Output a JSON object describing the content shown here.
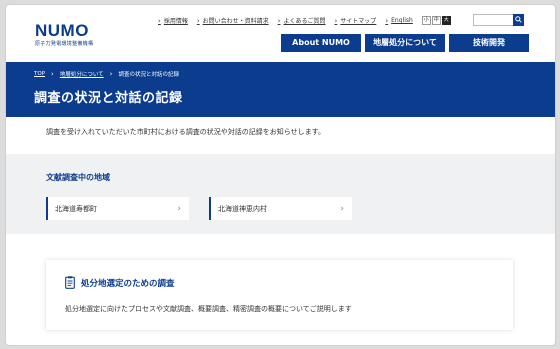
{
  "header": {
    "logo_word": "NUMO",
    "logo_sub": "原子力発電環境整備機構",
    "utility_links": [
      "採用情報",
      "お問い合わせ・資料請求",
      "よくあるご質問",
      "サイトマップ",
      "English"
    ],
    "font_size_buttons": [
      "小",
      "中",
      "大"
    ],
    "search_placeholder": "",
    "nav": [
      "About NUMO",
      "地層処分について",
      "技術開発"
    ]
  },
  "breadcrumb": [
    "TOP",
    "地層処分について",
    "調査の状況と対話の記録"
  ],
  "page_title": "調査の状況と対話の記録",
  "intro": "調査を受け入れていただいた市町村における調査の状況や対話の記録をお知らせします。",
  "survey": {
    "title": "文献調査中の地域",
    "towns": [
      "北海道寿都町",
      "北海道神恵内村"
    ]
  },
  "card": {
    "title": "処分地選定のための調査",
    "description": "処分地選定に向けたプロセスや文献調査、概要調査、精密調査の概要についてご説明します"
  },
  "colors": {
    "brand": "#0b3c8d",
    "section_bg": "#f0f1f3"
  },
  "icons": [
    "search-icon",
    "chevron-right-icon",
    "document-icon"
  ]
}
